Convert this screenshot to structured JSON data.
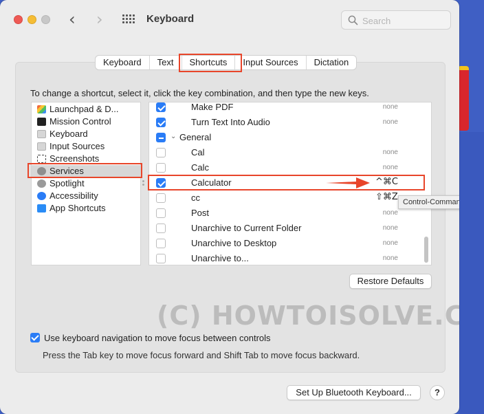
{
  "window": {
    "title": "Keyboard"
  },
  "search": {
    "placeholder": "Search"
  },
  "tabs": [
    {
      "label": "Keyboard"
    },
    {
      "label": "Text"
    },
    {
      "label": "Shortcuts",
      "active": true
    },
    {
      "label": "Input Sources"
    },
    {
      "label": "Dictation"
    }
  ],
  "instructions": "To change a shortcut, select it, click the key combination, and then type the new keys.",
  "categories": [
    {
      "label": "Launchpad & D...",
      "icon": "launchpad-icon"
    },
    {
      "label": "Mission Control",
      "icon": "mission-control-icon"
    },
    {
      "label": "Keyboard",
      "icon": "keyboard-icon"
    },
    {
      "label": "Input Sources",
      "icon": "input-sources-icon"
    },
    {
      "label": "Screenshots",
      "icon": "screenshots-icon"
    },
    {
      "label": "Services",
      "icon": "gear-icon",
      "selected": true
    },
    {
      "label": "Spotlight",
      "icon": "spotlight-icon"
    },
    {
      "label": "Accessibility",
      "icon": "accessibility-icon"
    },
    {
      "label": "App Shortcuts",
      "icon": "app-store-icon"
    }
  ],
  "shortcuts": [
    {
      "label": "Make PDF",
      "state": "checked",
      "key": "none"
    },
    {
      "label": "Turn Text Into Audio",
      "state": "checked",
      "key": "none"
    },
    {
      "label": "General",
      "state": "mixed",
      "group": true,
      "key": ""
    },
    {
      "label": "Cal",
      "state": "unchecked",
      "key": "none"
    },
    {
      "label": "Calc",
      "state": "unchecked",
      "key": "none"
    },
    {
      "label": "Calculator",
      "state": "checked",
      "key": "^⌘C"
    },
    {
      "label": "cc",
      "state": "unchecked",
      "key": "⇧⌘Z"
    },
    {
      "label": "Post",
      "state": "unchecked",
      "key": "none"
    },
    {
      "label": "Unarchive to Current Folder",
      "state": "unchecked",
      "key": "none"
    },
    {
      "label": "Unarchive to Desktop",
      "state": "unchecked",
      "key": "none"
    },
    {
      "label": "Unarchive to...",
      "state": "unchecked",
      "key": "none"
    }
  ],
  "tooltip": "Control-Command-C",
  "buttons": {
    "restore_defaults": "Restore Defaults",
    "bluetooth": "Set Up Bluetooth Keyboard...",
    "help": "?"
  },
  "keyboard_navigation": {
    "label": "Use keyboard navigation to move focus between controls",
    "checked": true,
    "help_text": "Press the Tab key to move focus forward and Shift Tab to move focus backward."
  },
  "watermark": "(C) HOWTOISOLVE.COM",
  "colors": {
    "accent": "#2a7cf6",
    "annotation": "#e8452a"
  }
}
